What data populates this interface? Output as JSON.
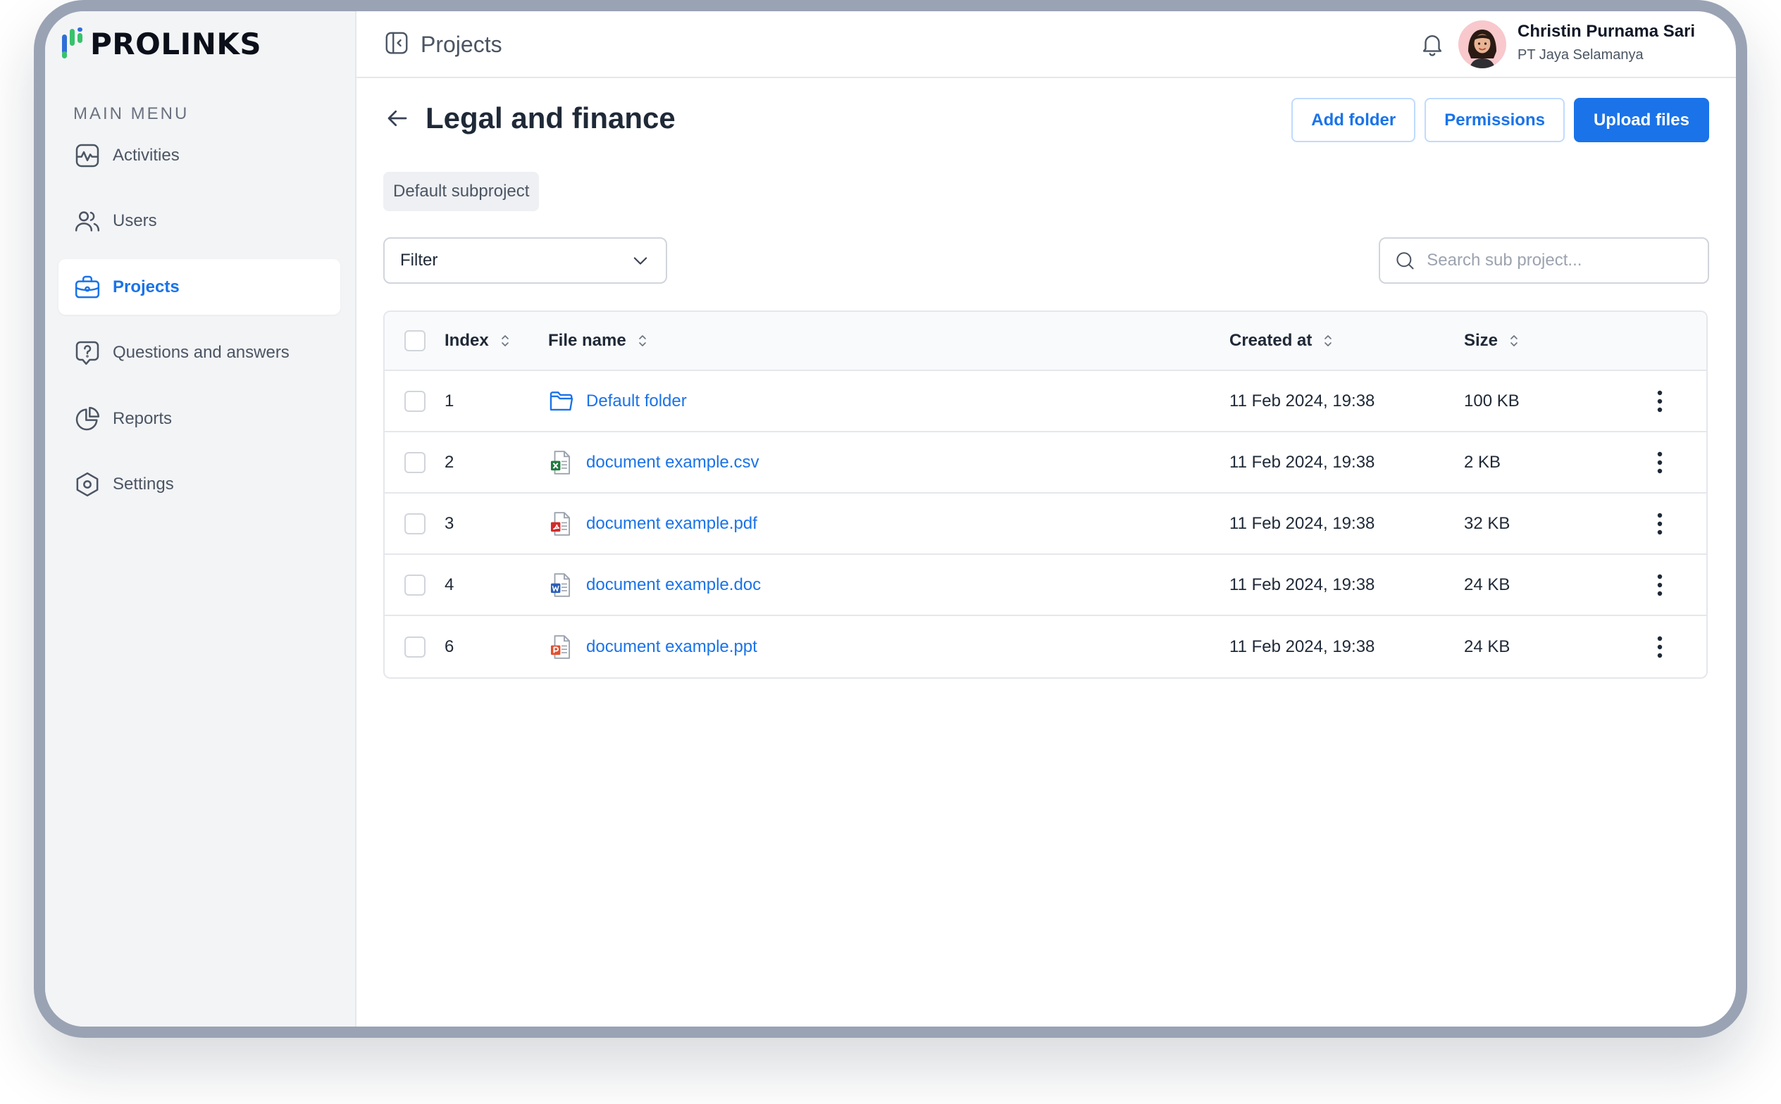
{
  "brand": {
    "name": "PROLINKS"
  },
  "sidebar": {
    "section_title": "MAIN MENU",
    "items": [
      {
        "label": "Activities",
        "icon": "activity-icon",
        "active": false
      },
      {
        "label": "Users",
        "icon": "users-icon",
        "active": false
      },
      {
        "label": "Projects",
        "icon": "briefcase-icon",
        "active": true
      },
      {
        "label": "Questions and answers",
        "icon": "question-bubble-icon",
        "active": false
      },
      {
        "label": "Reports",
        "icon": "pie-chart-icon",
        "active": false
      },
      {
        "label": "Settings",
        "icon": "settings-hexagon-icon",
        "active": false
      }
    ]
  },
  "topbar": {
    "breadcrumb": "Projects",
    "user": {
      "name": "Christin Purnama Sari",
      "org": "PT Jaya Selamanya"
    }
  },
  "page": {
    "title": "Legal and finance",
    "subproject_chip": "Default subproject",
    "actions": {
      "add_folder": "Add folder",
      "permissions": "Permissions",
      "upload": "Upload files"
    },
    "filter": {
      "label": "Filter"
    },
    "search": {
      "placeholder": "Search sub project...",
      "value": ""
    }
  },
  "table": {
    "columns": {
      "index": "Index",
      "file_name": "File name",
      "created_at": "Created at",
      "size": "Size"
    },
    "rows": [
      {
        "index": "1",
        "name": "Default folder",
        "type": "folder",
        "created_at": "11 Feb 2024, 19:38",
        "size": "100 KB"
      },
      {
        "index": "2",
        "name": "document example.csv",
        "type": "csv",
        "created_at": "11 Feb 2024, 19:38",
        "size": "2 KB"
      },
      {
        "index": "3",
        "name": "document example.pdf",
        "type": "pdf",
        "created_at": "11 Feb 2024, 19:38",
        "size": "32 KB"
      },
      {
        "index": "4",
        "name": "document example.doc",
        "type": "doc",
        "created_at": "11 Feb 2024, 19:38",
        "size": "24 KB"
      },
      {
        "index": "6",
        "name": "document example.ppt",
        "type": "ppt",
        "created_at": "11 Feb 2024, 19:38",
        "size": "24 KB"
      }
    ]
  },
  "colors": {
    "accent": "#1a73e8",
    "sidebar_bg": "#f3f4f6",
    "frame": "#9aa3b4",
    "csv": "#1f7a3d",
    "pdf": "#d12c2c",
    "doc": "#2b5fb8",
    "ppt": "#e1502f"
  }
}
